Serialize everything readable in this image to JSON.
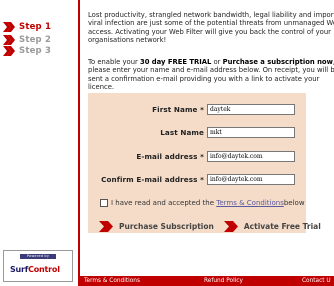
{
  "sidebar": {
    "steps": [
      {
        "label": "Step 1",
        "state": "active"
      },
      {
        "label": "Step 2",
        "state": "inactive"
      },
      {
        "label": "Step 3",
        "state": "inactive"
      }
    ],
    "logo": {
      "powered_by": "Powered by",
      "brand_a": "Surf",
      "brand_b": "Control"
    }
  },
  "intro": {
    "line1": "Lost productivity, strangled network bandwidth, legal liability and imported",
    "line2": "viral infection are just some of the potential threats from unmanaged Web",
    "line3": "access. Activating your Web Filter will give you back the control of your",
    "line4": "organisations network!"
  },
  "instructions": {
    "l1_a": "To enable your ",
    "l1_b": "30 day FREE TRIAL",
    "l1_c": " or ",
    "l1_d": "Purchase a subscription now",
    "l1_e": ",",
    "line2": "please enter your name and e-mail address below. On receipt, you will be",
    "line3": "sent a confirmation e-mail providing you with a link to activate your",
    "line4": "licence."
  },
  "form": {
    "first_name_label": "First Name *",
    "first_name_value": "daytek",
    "last_name_label": "Last Name",
    "last_name_value": "mkt",
    "email_label": "E-mail address *",
    "email_value": "info@daytek.com",
    "confirm_email_label": "Confirm E-mail address *",
    "confirm_email_value": "info@daytek.com",
    "agree_prefix": "I have read and accepted the ",
    "agree_link": "Terms & Conditions",
    "agree_suffix": " below"
  },
  "actions": {
    "purchase": "Purchase Subscription",
    "trial": "Activate Free Trial"
  },
  "footer": {
    "terms": "Terms & Conditions",
    "refund": "Refund Policy",
    "contact": "Contact U"
  },
  "colors": {
    "accent": "#c00000",
    "form_bg": "#f4dcc9"
  }
}
